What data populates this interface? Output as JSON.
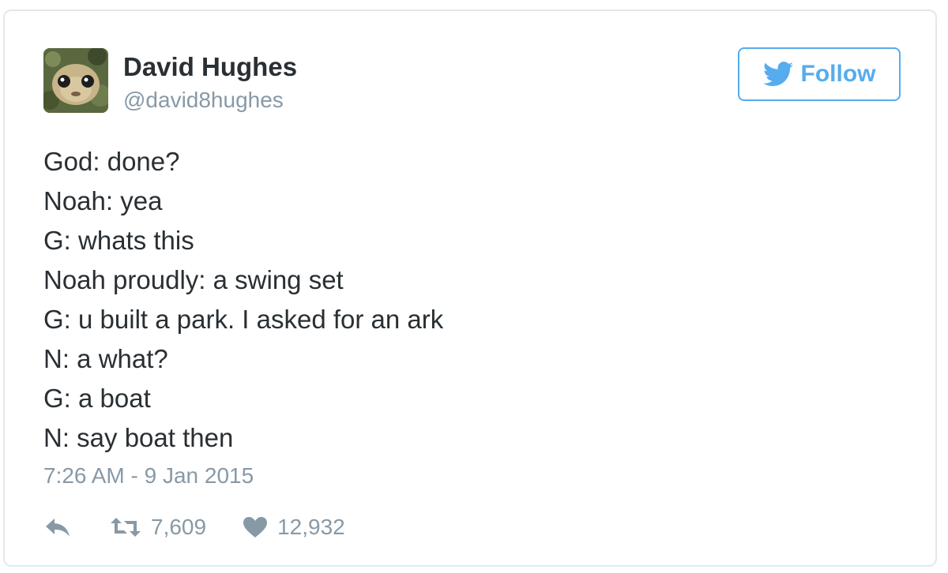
{
  "user": {
    "name": "David Hughes",
    "handle": "@david8hughes"
  },
  "follow_button": {
    "label": "Follow",
    "icon": "twitter-bird-icon",
    "color": "#55acee"
  },
  "tweet": {
    "lines": [
      "God: done?",
      "Noah: yea",
      "G: whats this",
      "Noah proudly: a swing set",
      "G: u built a park. I asked for an ark",
      "N: a what?",
      "G: a boat",
      "N: say boat then"
    ],
    "timestamp": "7:26 AM - 9 Jan 2015"
  },
  "actions": {
    "reply_icon": "reply-icon",
    "retweet_icon": "retweet-icon",
    "like_icon": "heart-icon",
    "retweets": "7,609",
    "likes": "12,932"
  },
  "colors": {
    "text": "#292f33",
    "muted": "#8899a6",
    "border": "#e1e8ed"
  }
}
